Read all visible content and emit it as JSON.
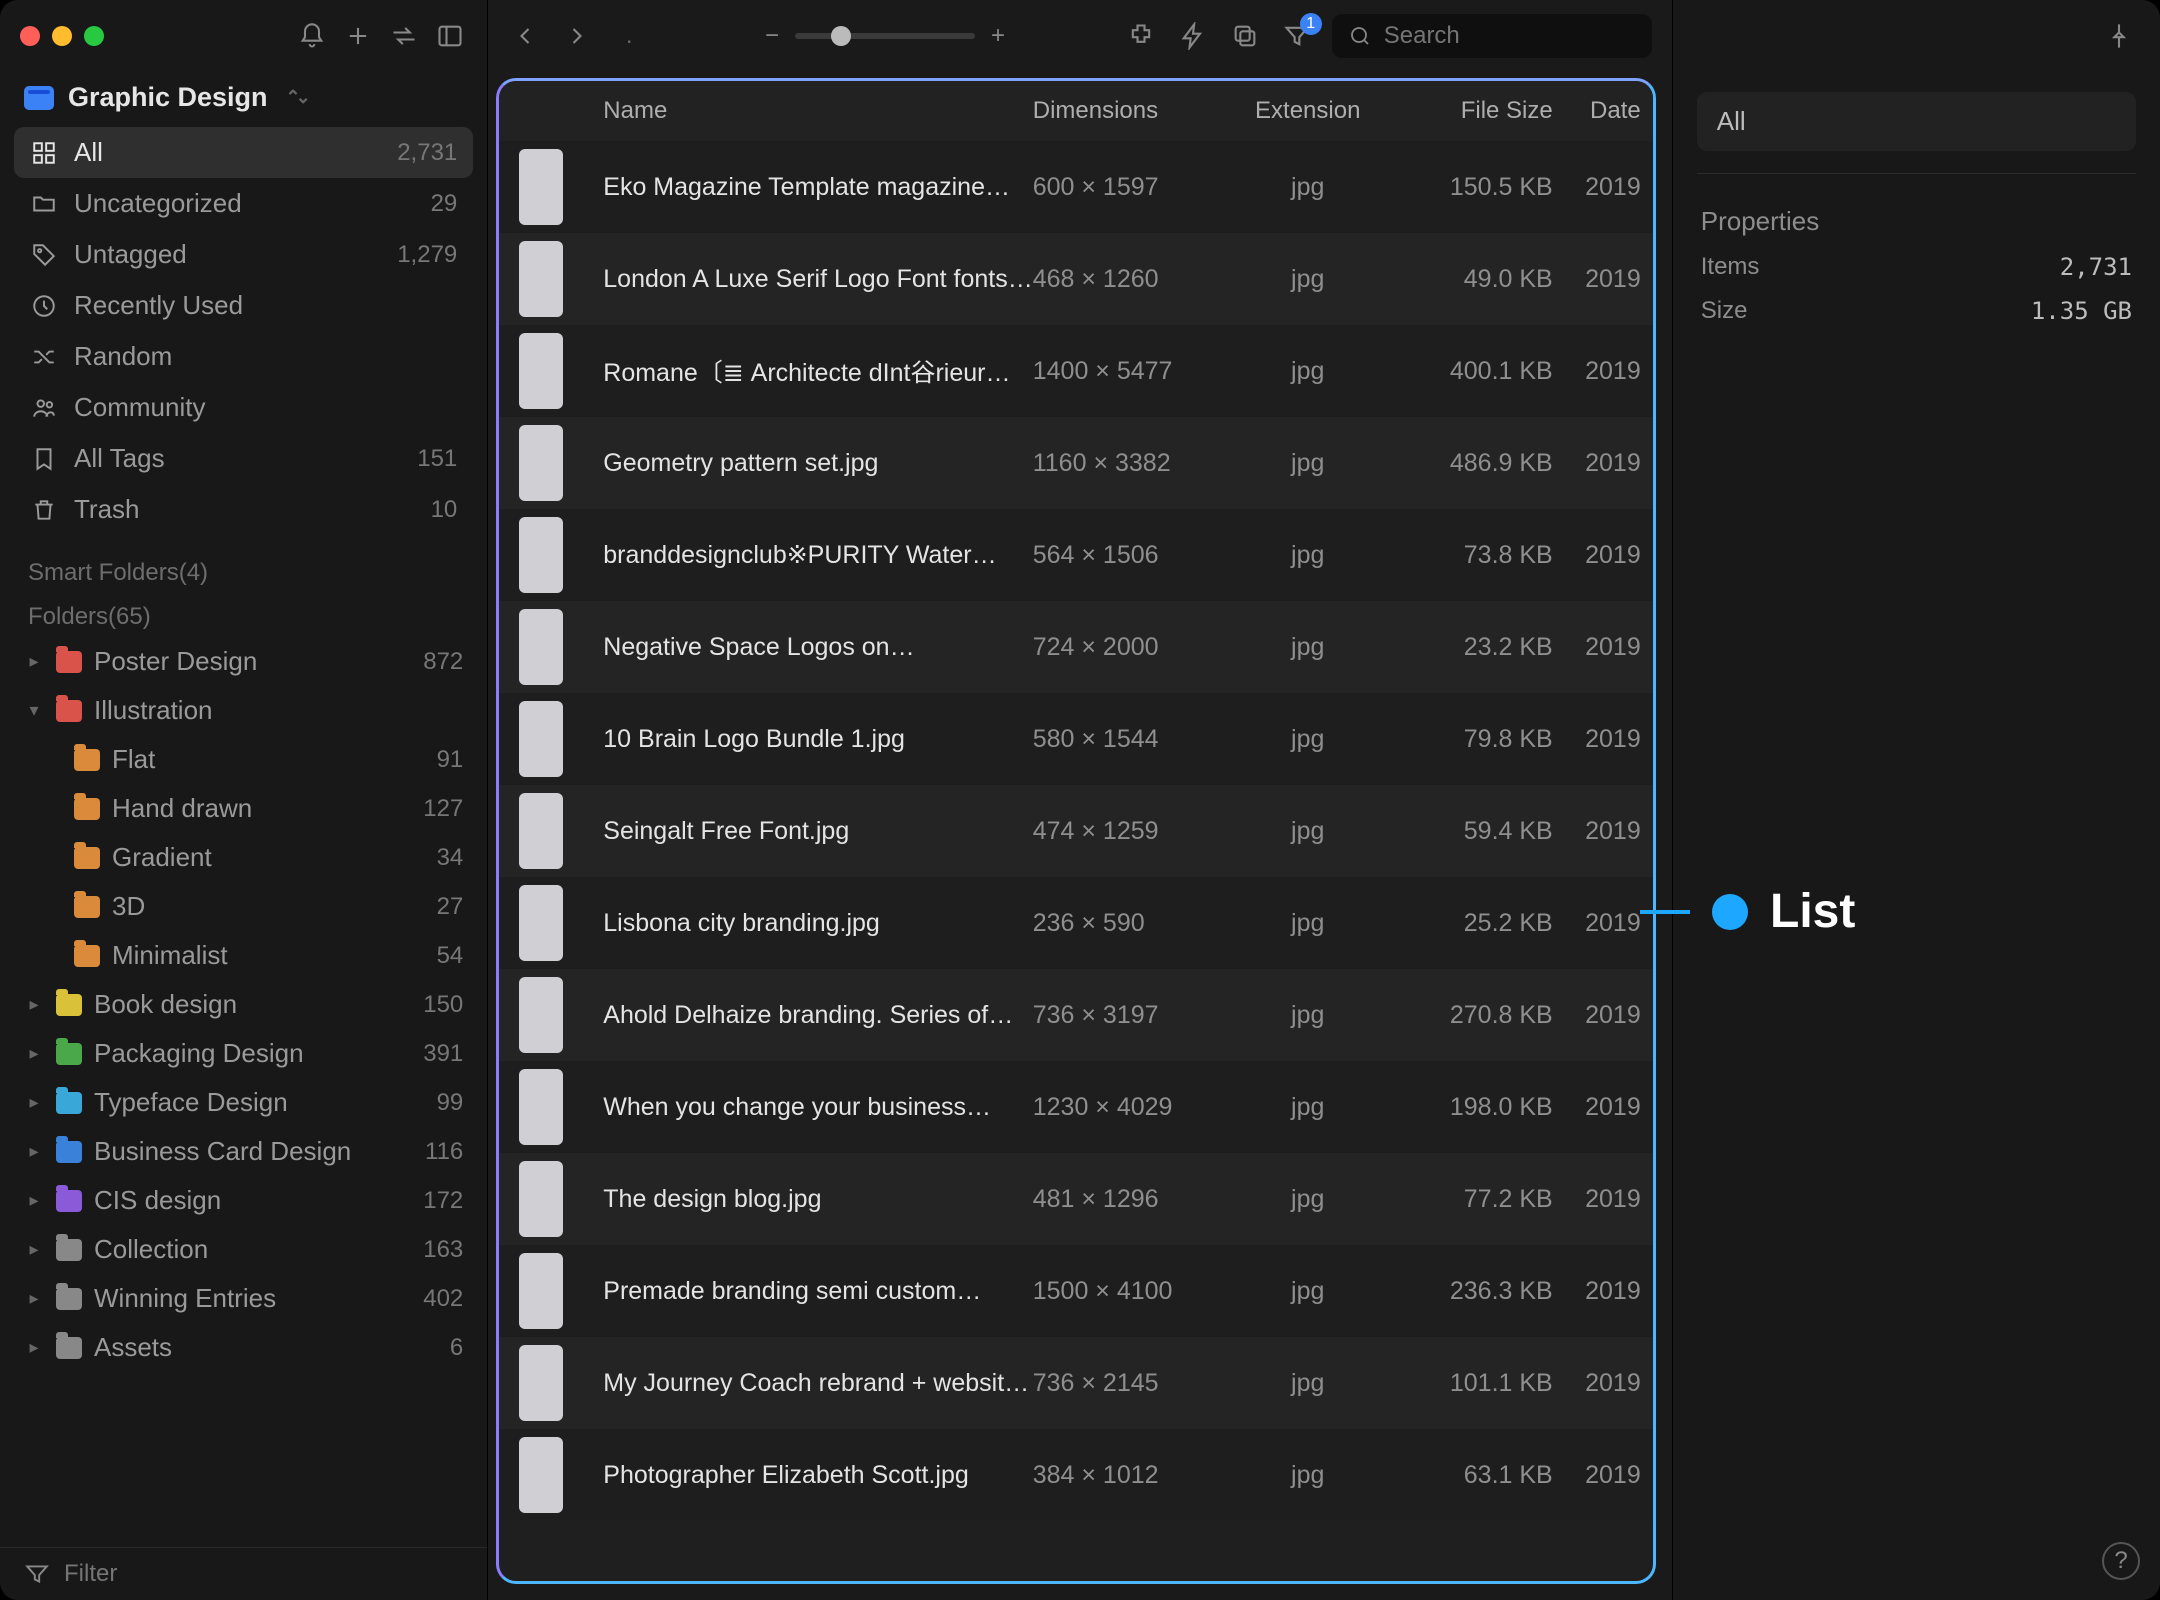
{
  "library_name": "Graphic Design",
  "search_placeholder": "Search",
  "filter_placeholder": "Filter",
  "filter_badge": "1",
  "callout_label": "List",
  "nav": [
    {
      "icon": "grid",
      "label": "All",
      "count": "2,731",
      "active": true
    },
    {
      "icon": "folder",
      "label": "Uncategorized",
      "count": "29"
    },
    {
      "icon": "tag",
      "label": "Untagged",
      "count": "1,279"
    },
    {
      "icon": "clock",
      "label": "Recently Used",
      "count": ""
    },
    {
      "icon": "shuffle",
      "label": "Random",
      "count": ""
    },
    {
      "icon": "people",
      "label": "Community",
      "count": ""
    },
    {
      "icon": "bookmark",
      "label": "All Tags",
      "count": "151"
    },
    {
      "icon": "trash",
      "label": "Trash",
      "count": "10"
    }
  ],
  "smart_folders_label": "Smart Folders(4)",
  "folders_label": "Folders(65)",
  "folders": [
    {
      "label": "Poster Design",
      "count": "872",
      "color": "#d9534a",
      "expandable": true
    },
    {
      "label": "Illustration",
      "count": "",
      "color": "#d9534a",
      "expandable": true,
      "expanded": true
    },
    {
      "label": "Flat",
      "count": "91",
      "color": "#d98a3a",
      "indent": true
    },
    {
      "label": "Hand drawn",
      "count": "127",
      "color": "#d98a3a",
      "indent": true
    },
    {
      "label": "Gradient",
      "count": "34",
      "color": "#d98a3a",
      "indent": true
    },
    {
      "label": "3D",
      "count": "27",
      "color": "#d98a3a",
      "indent": true
    },
    {
      "label": "Minimalist",
      "count": "54",
      "color": "#d98a3a",
      "indent": true
    },
    {
      "label": "Book design",
      "count": "150",
      "color": "#d9c23a",
      "expandable": true
    },
    {
      "label": "Packaging Design",
      "count": "391",
      "color": "#4aa84a",
      "expandable": true
    },
    {
      "label": "Typeface Design",
      "count": "99",
      "color": "#3aa7d9",
      "expandable": true
    },
    {
      "label": "Business Card Design",
      "count": "116",
      "color": "#3a82d9",
      "expandable": true
    },
    {
      "label": "CIS design",
      "count": "172",
      "color": "#8a5ad9",
      "expandable": true
    },
    {
      "label": "Collection",
      "count": "163",
      "color": "#888888",
      "expandable": true
    },
    {
      "label": "Winning Entries",
      "count": "402",
      "color": "#888888",
      "expandable": true
    },
    {
      "label": "Assets",
      "count": "6",
      "color": "#888888",
      "expandable": true
    }
  ],
  "columns": {
    "name": "Name",
    "dimensions": "Dimensions",
    "extension": "Extension",
    "size": "File Size",
    "date": "Date"
  },
  "rows": [
    {
      "name": "Eko Magazine Template magazine…",
      "dim": "600 × 1597",
      "ext": "jpg",
      "size": "150.5 KB",
      "date": "2019"
    },
    {
      "name": "London A Luxe Serif Logo Font fonts…",
      "dim": "468 × 1260",
      "ext": "jpg",
      "size": "49.0 KB",
      "date": "2019"
    },
    {
      "name": "Romane〔≣ Architecte dInt谷rieur…",
      "dim": "1400 × 5477",
      "ext": "jpg",
      "size": "400.1 KB",
      "date": "2019"
    },
    {
      "name": "Geometry pattern set.jpg",
      "dim": "1160 × 3382",
      "ext": "jpg",
      "size": "486.9 KB",
      "date": "2019"
    },
    {
      "name": "branddesignclub※PURITY Water…",
      "dim": "564 × 1506",
      "ext": "jpg",
      "size": "73.8 KB",
      "date": "2019"
    },
    {
      "name": "Negative Space Logos on…",
      "dim": "724 × 2000",
      "ext": "jpg",
      "size": "23.2 KB",
      "date": "2019"
    },
    {
      "name": "10 Brain Logo Bundle 1.jpg",
      "dim": "580 × 1544",
      "ext": "jpg",
      "size": "79.8 KB",
      "date": "2019"
    },
    {
      "name": "Seingalt Free Font.jpg",
      "dim": "474 × 1259",
      "ext": "jpg",
      "size": "59.4 KB",
      "date": "2019"
    },
    {
      "name": "Lisbona city branding.jpg",
      "dim": "236 × 590",
      "ext": "jpg",
      "size": "25.2 KB",
      "date": "2019"
    },
    {
      "name": "Ahold Delhaize branding. Series of…",
      "dim": "736 × 3197",
      "ext": "jpg",
      "size": "270.8 KB",
      "date": "2019"
    },
    {
      "name": "When you change your business…",
      "dim": "1230 × 4029",
      "ext": "jpg",
      "size": "198.0 KB",
      "date": "2019"
    },
    {
      "name": "The design blog.jpg",
      "dim": "481 × 1296",
      "ext": "jpg",
      "size": "77.2 KB",
      "date": "2019"
    },
    {
      "name": "Premade branding semi custom…",
      "dim": "1500 × 4100",
      "ext": "jpg",
      "size": "236.3 KB",
      "date": "2019"
    },
    {
      "name": "My Journey Coach rebrand + websit…",
      "dim": "736 × 2145",
      "ext": "jpg",
      "size": "101.1 KB",
      "date": "2019"
    },
    {
      "name": "Photographer Elizabeth Scott.jpg",
      "dim": "384 × 1012",
      "ext": "jpg",
      "size": "63.1 KB",
      "date": "2019"
    }
  ],
  "inspector": {
    "tab": "All",
    "section": "Properties",
    "items_label": "Items",
    "items_value": "2,731",
    "size_label": "Size",
    "size_value": "1.35 GB"
  }
}
